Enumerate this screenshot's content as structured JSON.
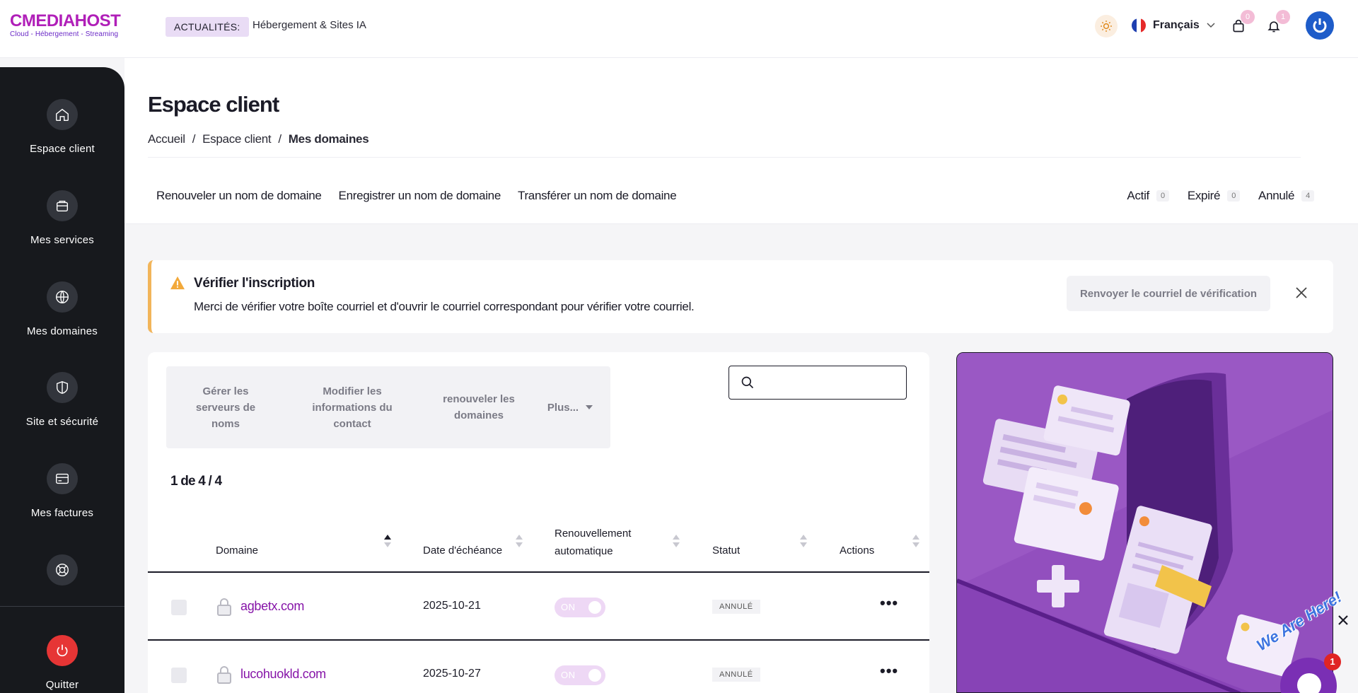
{
  "topbar": {
    "logo_main": "CMEDIAHOST",
    "logo_sub": "Cloud - Hébergement - Streaming",
    "news_badge": "ACTUALITÉS:",
    "news_text": "Hébergement & Sites IA",
    "language": "Français",
    "cart_count": "0",
    "notif_count": "1"
  },
  "sidebar": {
    "items": [
      {
        "label": "Espace client",
        "icon": "home-icon"
      },
      {
        "label": "Mes services",
        "icon": "box-icon"
      },
      {
        "label": "Mes domaines",
        "icon": "globe-icon"
      },
      {
        "label": "Site et sécurité",
        "icon": "shield-icon"
      },
      {
        "label": "Mes factures",
        "icon": "credit-card-icon"
      },
      {
        "label": "",
        "icon": "lifebuoy-icon"
      }
    ],
    "quit_label": "Quitter"
  },
  "header": {
    "title": "Espace client",
    "breadcrumb": [
      "Accueil",
      "Espace client",
      "Mes domaines"
    ],
    "breadcrumb_sep": "/",
    "action_tabs": [
      "Renouveler un nom de domaine",
      "Enregistrer un nom de domaine",
      "Transférer un nom de domaine"
    ],
    "status_tabs": [
      {
        "label": "Actif",
        "count": "0"
      },
      {
        "label": "Expiré",
        "count": "0"
      },
      {
        "label": "Annulé",
        "count": "4"
      }
    ]
  },
  "alert": {
    "title": "Vérifier l'inscription",
    "message": "Merci de vérifier votre boîte courriel et d'ouvrir le courriel correspondant pour vérifier votre courriel.",
    "button": "Renvoyer le courriel de vérification"
  },
  "bulk_actions": {
    "manage_ns": "Gérer les serveurs de noms",
    "modify_contact": "Modifier les informations du contact",
    "renew": "renouveler les domaines",
    "more": "Plus..."
  },
  "search": {
    "placeholder": ""
  },
  "table": {
    "count_text": "1 de 4 / 4",
    "columns": {
      "domain": "Domaine",
      "due_date": "Date d'échéance",
      "auto_renew_1": "Renouvellement",
      "auto_renew_2": "automatique",
      "status": "Statut",
      "actions": "Actions"
    },
    "rows": [
      {
        "domain": "agbetx.com",
        "date": "2025-10-21",
        "toggle": "ON",
        "status": "ANNULÉ",
        "more": "•••"
      },
      {
        "domain": "lucohuokld.com",
        "date": "2025-10-27",
        "toggle": "ON",
        "status": "ANNULÉ",
        "more": "•••"
      }
    ]
  },
  "chat": {
    "text": "We Are Here!",
    "badge": "1"
  },
  "colors": {
    "brand": "#b01fb8",
    "sidebar_bg": "#17191d",
    "alert_accent": "#f2b55a",
    "domain_link": "#8614a8",
    "illustration_bg": "#9a58c4"
  }
}
